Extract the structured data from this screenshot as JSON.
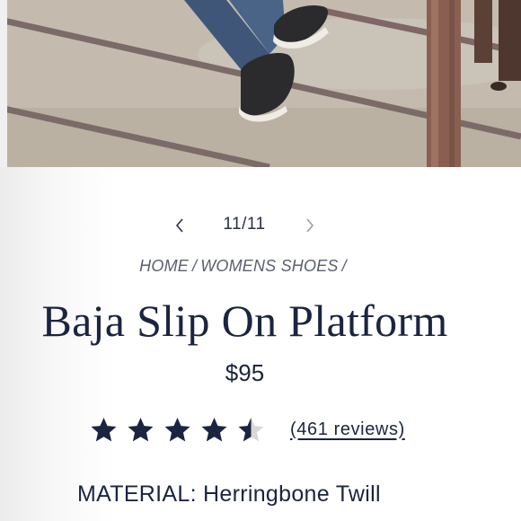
{
  "gallery": {
    "current": 11,
    "total": 11,
    "counter": "11/11",
    "prev_icon": "chevron-left-icon",
    "next_icon": "chevron-right-icon"
  },
  "breadcrumb": {
    "items": [
      "HOME",
      "WOMENS SHOES"
    ],
    "separator": "/"
  },
  "product": {
    "title": "Baja Slip On Platform",
    "price": "$95"
  },
  "rating": {
    "stars": 4.5,
    "max": 5,
    "reviews_label": "(461 reviews)"
  },
  "details": {
    "material": "MATERIAL: Herringbone Twill"
  },
  "colors": {
    "navy": "#1b2440",
    "breadcrumb": "#5b6070",
    "star_empty": "#d8d8d8"
  }
}
